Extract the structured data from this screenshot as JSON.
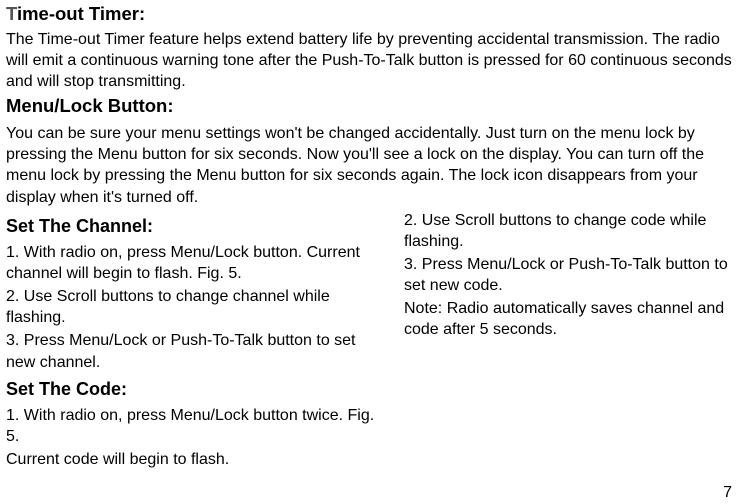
{
  "section1": {
    "heading_first": "T",
    "heading_rest": "ime-out Timer:",
    "body": "The Time-out Timer feature helps extend battery life by preventing accidental transmission. The radio will emit a continuous warning tone after the Push-To-Talk button is pressed for 60 continuous seconds and will stop transmitting."
  },
  "section2": {
    "heading": "Menu/Lock Button:",
    "body": "You can be sure your menu settings won't be changed accidentally. Just turn on the menu lock by pressing the Menu button for six seconds. Now you'll see a lock on the display. You can turn off the menu lock by pressing the Menu button for six seconds again. The lock icon disappears from your display when it's turned off."
  },
  "section3": {
    "heading": "Set The Channel:",
    "line1": "1. With radio on, press Menu/Lock button. Current channel will begin to flash. Fig. 5.",
    "line2": "2. Use Scroll buttons to change channel while flashing.",
    "line3": "3. Press Menu/Lock or Push-To-Talk button to set new channel."
  },
  "section4": {
    "heading": "Set The Code:",
    "line1": "1. With radio on, press Menu/Lock button twice. Fig. 5.",
    "line2": "Current code will begin to flash."
  },
  "right_col": {
    "line1": "2. Use Scroll buttons to change code while flashing.",
    "line2": "3. Press Menu/Lock or Push-To-Talk button to set new code.",
    "line3": "Note: Radio automatically saves channel and code after 5 seconds."
  },
  "page_number": "7"
}
